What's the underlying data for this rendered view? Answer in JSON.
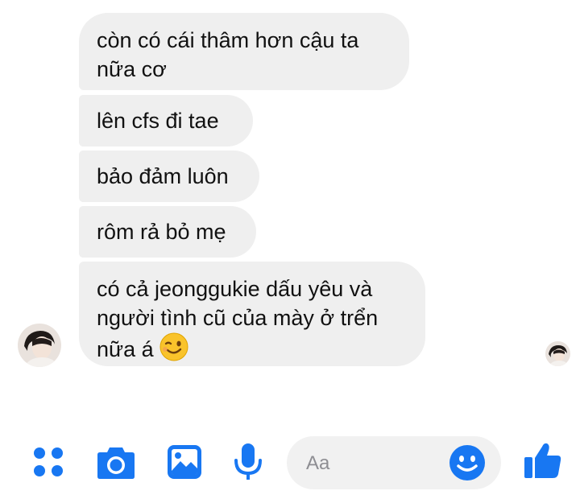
{
  "messages": [
    {
      "lines": [
        "còn có cái thâm hơn cậu ta",
        "nữa cơ"
      ]
    },
    {
      "lines": [
        "lên cfs đi tae"
      ]
    },
    {
      "lines": [
        "bảo đảm luôn"
      ]
    },
    {
      "lines": [
        "rôm rả bỏ mẹ"
      ]
    },
    {
      "lines": [
        "có cả jeonggukie dấu yêu và",
        "người tình cũ của mày ở trển",
        "nữa á"
      ],
      "emoji": "winking-face"
    }
  ],
  "composer": {
    "placeholder": "Aa",
    "accent_color": "#1877f2",
    "icons": [
      "more-apps-icon",
      "camera-icon",
      "gallery-icon",
      "microphone-icon",
      "emoji-smile-icon",
      "thumbs-up-icon"
    ]
  },
  "colors": {
    "bubble_bg": "#efefef",
    "input_bg": "#f1f1f1",
    "accent": "#1877f2"
  }
}
